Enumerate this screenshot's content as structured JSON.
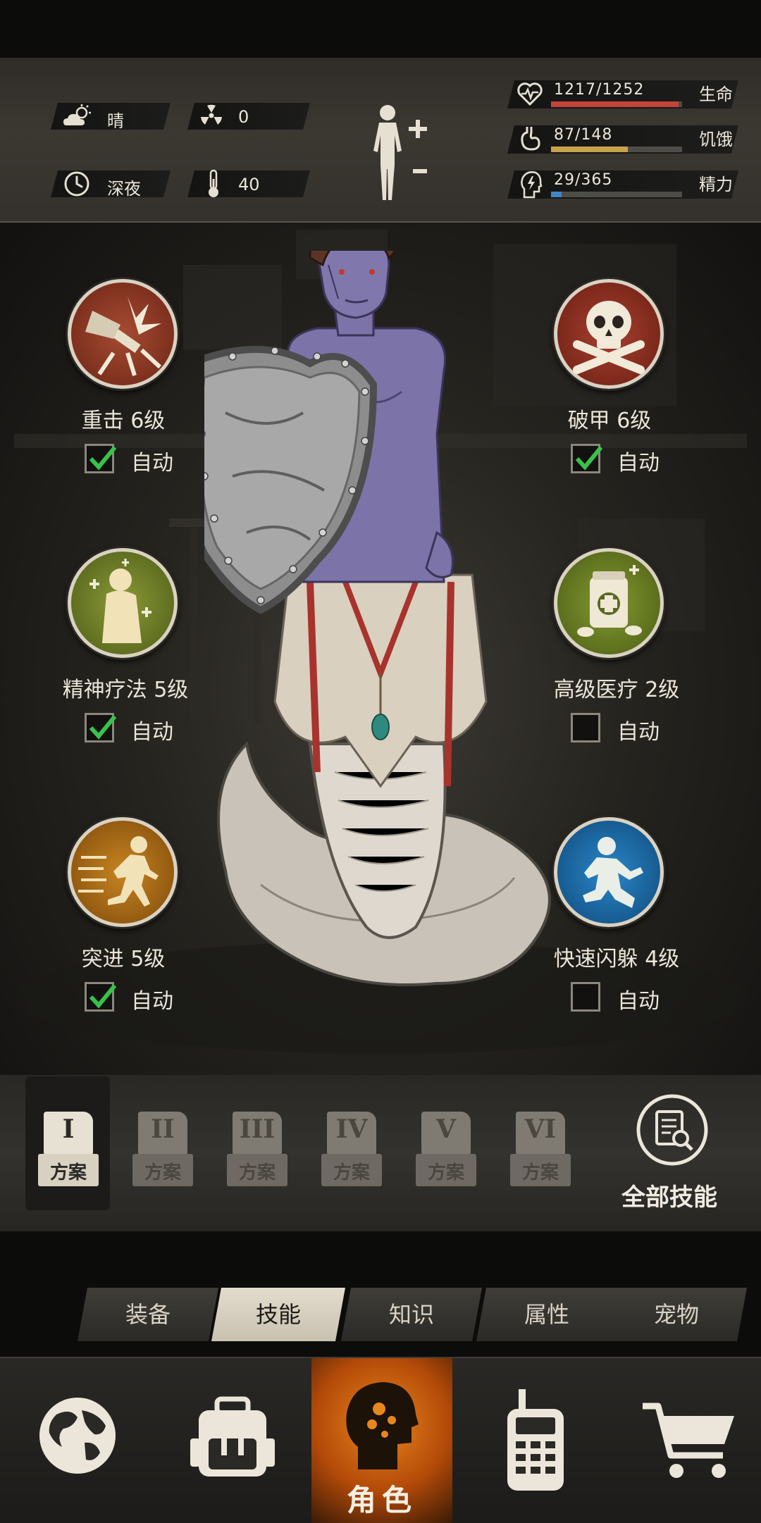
{
  "status": {
    "weather": "晴",
    "radiation": "0",
    "time_of_day": "深夜",
    "temperature": "40",
    "health": {
      "value": "1217/1252",
      "label": "生命",
      "fraction": 0.972,
      "color": "#c4443a"
    },
    "hunger": {
      "value": "87/148",
      "label": "饥饿",
      "fraction": 0.588,
      "color": "#c9a24c"
    },
    "energy": {
      "value": "29/365",
      "label": "精力",
      "fraction": 0.079,
      "color": "#3f86c9"
    }
  },
  "skills": [
    {
      "name": "重击 6级",
      "auto_label": "自动",
      "checked": true,
      "icon": "heavy-strike-icon"
    },
    {
      "name": "破甲 6级",
      "auto_label": "自动",
      "checked": true,
      "icon": "skull-crossbones-icon"
    },
    {
      "name": "精神疗法 5级",
      "auto_label": "自动",
      "checked": true,
      "icon": "mental-therapy-icon"
    },
    {
      "name": "高级医疗 2级",
      "auto_label": "自动",
      "checked": false,
      "icon": "medical-kit-icon"
    },
    {
      "name": "突进 5级",
      "auto_label": "自动",
      "checked": true,
      "icon": "dash-icon"
    },
    {
      "name": "快速闪躲 4级",
      "auto_label": "自动",
      "checked": false,
      "icon": "quick-dodge-icon"
    }
  ],
  "plans": [
    {
      "numeral": "I",
      "label": "方案",
      "active": true
    },
    {
      "numeral": "II",
      "label": "方案",
      "active": false
    },
    {
      "numeral": "III",
      "label": "方案",
      "active": false
    },
    {
      "numeral": "IV",
      "label": "方案",
      "active": false
    },
    {
      "numeral": "V",
      "label": "方案",
      "active": false
    },
    {
      "numeral": "VI",
      "label": "方案",
      "active": false
    }
  ],
  "all_skills_label": "全部技能",
  "tabs": [
    "装备",
    "技能",
    "知识",
    "属性",
    "宠物"
  ],
  "active_tab": "技能",
  "nav": {
    "character_label": "角色"
  }
}
